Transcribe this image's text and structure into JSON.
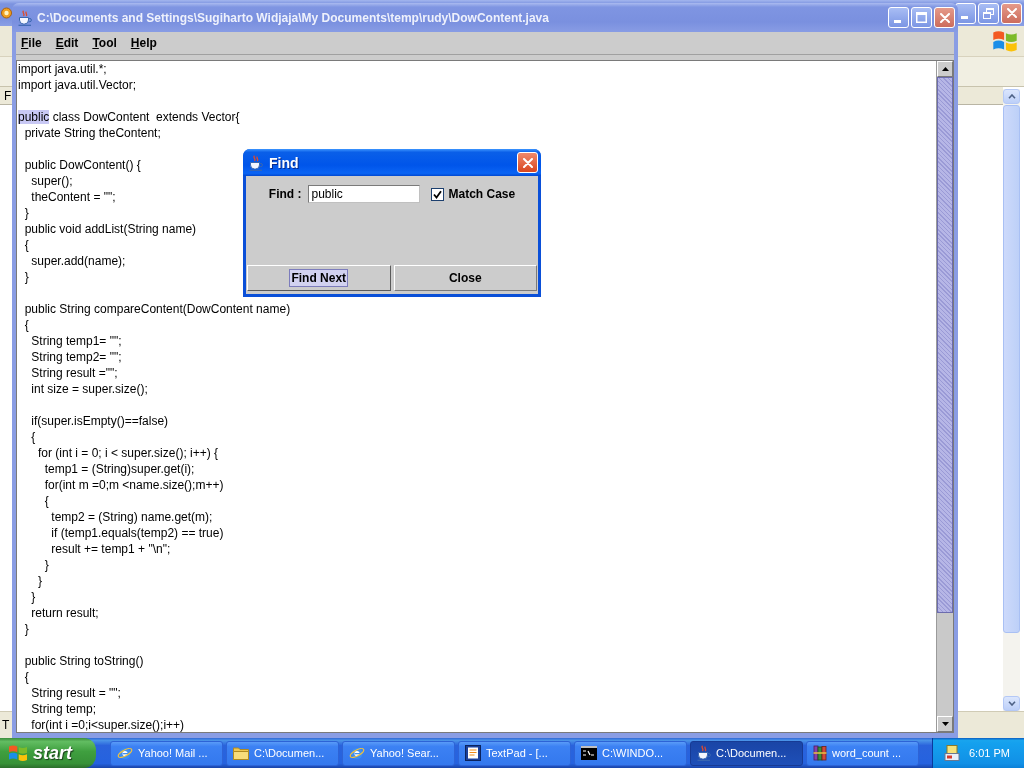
{
  "background_window": {
    "menu_fragment": "F",
    "status_fragment": "T"
  },
  "window": {
    "title": "C:\\Documents and Settings\\Sugiharto Widjaja\\My Documents\\temp\\rudy\\DowContent.java",
    "active": false
  },
  "menu": [
    "File",
    "Edit",
    "Tool",
    "Help"
  ],
  "editor": {
    "blocks": [
      {
        "lines": [
          {
            "text": "import java.util.*;"
          },
          {
            "text": "import java.util.Vector;"
          }
        ]
      },
      {
        "lines": [
          {
            "highlighted": "public",
            "text": " class DowContent  extends Vector{"
          },
          {
            "text": "  private String theContent;"
          }
        ]
      },
      {
        "lines": [
          {
            "text": "  public DowContent() {"
          },
          {
            "text": "    super();"
          },
          {
            "text": "    theContent = \"\";"
          },
          {
            "text": "  }"
          },
          {
            "text": "  public void addList(String name)"
          },
          {
            "text": "  {"
          },
          {
            "text": "    super.add(name);"
          },
          {
            "text": "  }"
          }
        ]
      },
      {
        "lines": [
          {
            "text": "  public String compareContent(DowContent name)"
          },
          {
            "text": "  {"
          },
          {
            "text": "    String temp1= \"\";"
          },
          {
            "text": "    String temp2= \"\";"
          },
          {
            "text": "    String result =\"\";"
          },
          {
            "text": "    int size = super.size();"
          }
        ]
      },
      {
        "lines": [
          {
            "text": "    if(super.isEmpty()==false)"
          },
          {
            "text": "    {"
          },
          {
            "text": "      for (int i = 0; i < super.size(); i++) {"
          },
          {
            "text": "        temp1 = (String)super.get(i);"
          },
          {
            "text": "        for(int m =0;m <name.size();m++)"
          },
          {
            "text": "        {"
          },
          {
            "text": "          temp2 = (String) name.get(m);"
          },
          {
            "text": "          if (temp1.equals(temp2) == true)"
          },
          {
            "text": "          result += temp1 + \"\\n\";"
          },
          {
            "text": "        }"
          },
          {
            "text": "      }"
          },
          {
            "text": "    }"
          },
          {
            "text": "    return result;"
          },
          {
            "text": "  }"
          }
        ]
      },
      {
        "lines": [
          {
            "text": "  public String toString()"
          },
          {
            "text": "  {"
          },
          {
            "text": "    String result = \"\";"
          },
          {
            "text": "    String temp;"
          },
          {
            "text": "    for(int i =0;i<super.size();i++)"
          }
        ]
      }
    ]
  },
  "find_dialog": {
    "title": "Find",
    "active": true,
    "find_label": "Find :",
    "find_value": "public",
    "match_case": {
      "label": "Match Case",
      "checked": true
    },
    "buttons": [
      {
        "label": "Find Next",
        "focused": true
      },
      {
        "label": "Close",
        "focused": false
      }
    ]
  },
  "taskbar": {
    "start_label": "start",
    "tasks": [
      {
        "label": "Yahoo! Mail ...",
        "kind": "browser",
        "selected": false
      },
      {
        "label": "C:\\Documen...",
        "kind": "folder",
        "selected": false
      },
      {
        "label": "Yahoo! Sear...",
        "kind": "browser",
        "selected": false
      },
      {
        "label": "TextPad - [...",
        "kind": "editor",
        "selected": false
      },
      {
        "label": "C:\\WINDO...",
        "kind": "console",
        "selected": false
      },
      {
        "label": "C:\\Documen...",
        "kind": "java",
        "selected": true
      },
      {
        "label": "word_count ...",
        "kind": "archive",
        "selected": false
      }
    ],
    "clock": "6:01 PM"
  }
}
